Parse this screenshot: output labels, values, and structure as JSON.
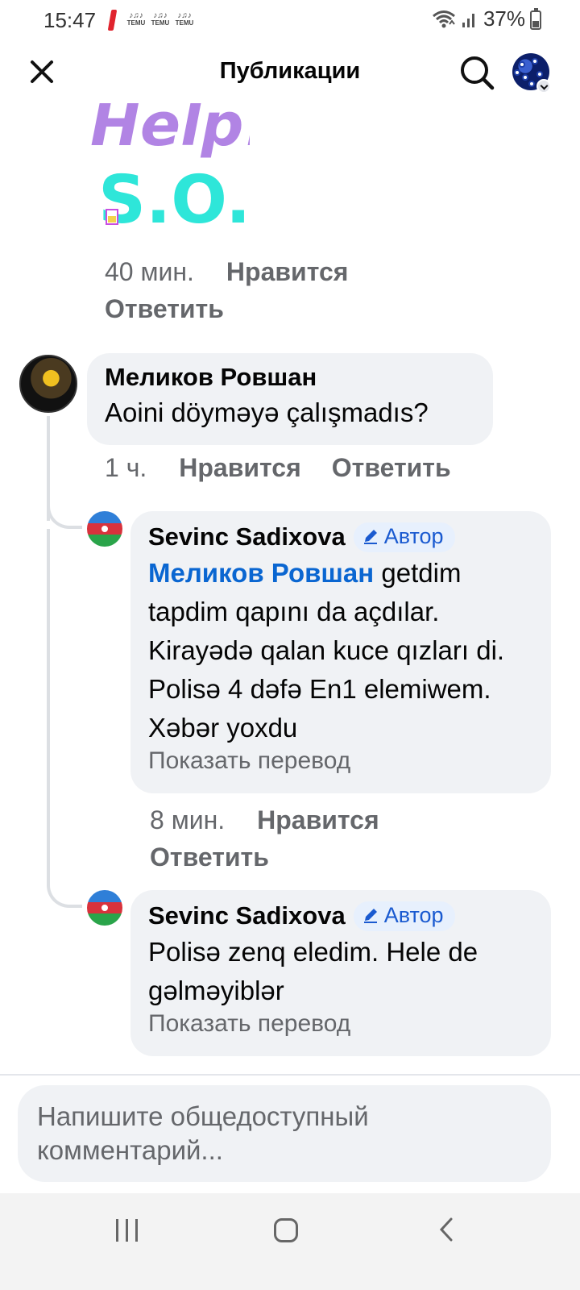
{
  "status_bar": {
    "time": "15:47",
    "notif_apps": [
      "TEMU",
      "TEMU",
      "TEMU"
    ],
    "battery": "37%"
  },
  "header": {
    "title": "Публикации"
  },
  "sticker": {
    "line1": "Help!",
    "line2": "S.O.S"
  },
  "comments": [
    {
      "time": "40 мин.",
      "like_label": "Нравится",
      "reply_label": "Ответить"
    },
    {
      "author": "Меликов Ровшан",
      "text": "Aoini döyməyə çalışmadıs?",
      "time": "1 ч.",
      "like_label": "Нравится",
      "reply_label": "Ответить",
      "replies": [
        {
          "author": "Sevinc Sadixova",
          "badge": "Автор",
          "mention": "Меликов Ровшан",
          "text": "getdim tapdim  qapını da açdılar. Kirayədə qalan kuce qızları di. Polisə 4 dəfə En1 elemiwem. Xəbər yoxdu",
          "translate": "Показать перевод",
          "time": "8 мин.",
          "like_label": "Нравится",
          "reply_label": "Ответить"
        },
        {
          "author": "Sevinc Sadixova",
          "badge": "Автор",
          "text": "Polisə zenq eledim. Hele de gəlməyiblər",
          "translate": "Показать перевод"
        }
      ]
    }
  ],
  "composer": {
    "placeholder": "Напишите общедоступный комментарий..."
  },
  "colors": {
    "bubble": "#f0f2f5",
    "mention": "#0a66d1",
    "meta": "#65676b",
    "badge_bg": "#e7f0fd"
  }
}
